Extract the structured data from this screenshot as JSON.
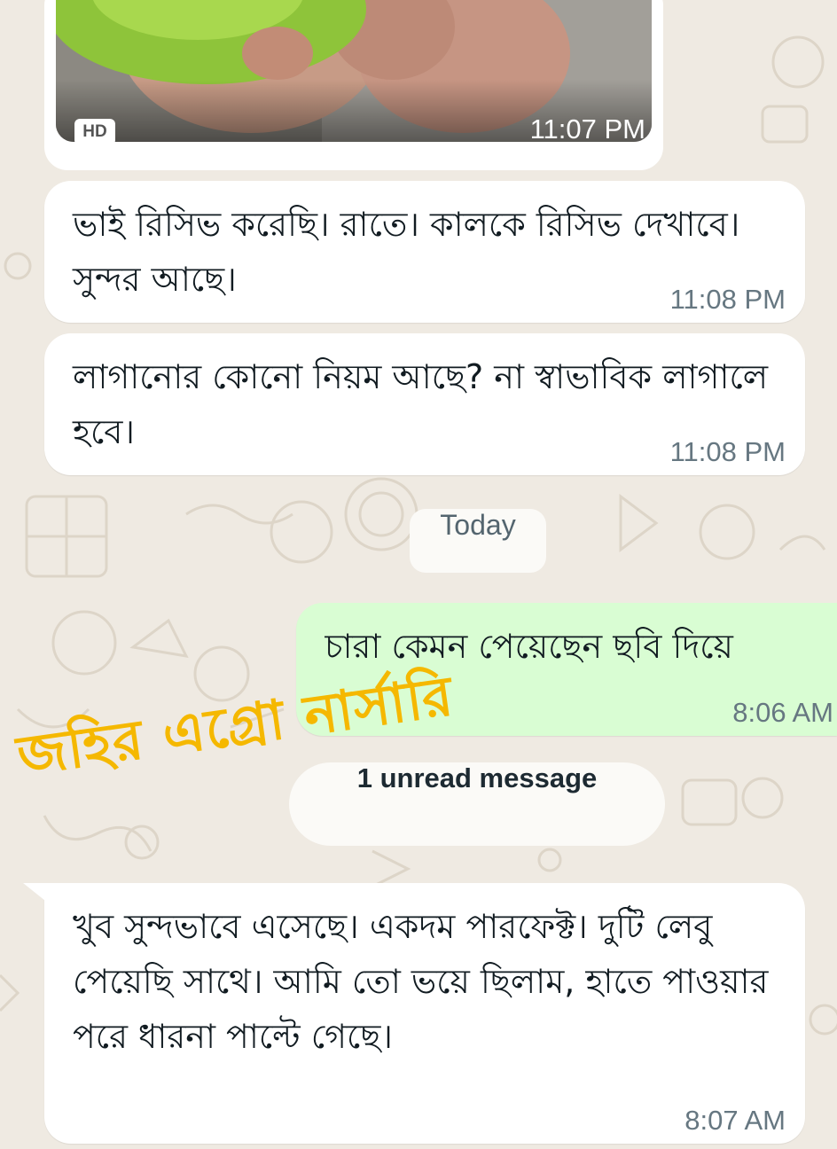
{
  "theme": {
    "background": "#efeae2",
    "incoming_bubble": "#ffffff",
    "outgoing_bubble": "#d9fdd3",
    "timestamp_color": "#667781",
    "watermark_color": "#f5b800"
  },
  "image_message": {
    "badge": "HD",
    "time": "11:07 PM"
  },
  "messages": [
    {
      "direction": "incoming",
      "text": "ভাই রিসিভ করেছি। রাতে। কালকে রিসিভ দেখাবে। সুন্দর আছে।",
      "time": "11:08 PM"
    },
    {
      "direction": "incoming",
      "text": "লাগানোর কোনো নিয়ম আছে? না স্বাভাবিক লাগালে হবে।",
      "time": "11:08 PM"
    },
    {
      "direction": "outgoing",
      "text": "চারা কেমন পেয়েছেন ছবি দিয়ে",
      "time": "8:06 AM"
    },
    {
      "direction": "incoming",
      "text": "খুব সুন্দভাবে এসেছে। একদম পারফেক্ট। দুটি লেবু পেয়েছি সাথে। আমি তো ভয়ে ছিলাম, হাতে পাওয়ার পরে ধারনা পাল্টে গেছে।",
      "time": "8:07 AM"
    }
  ],
  "date_separator": "Today",
  "unread_banner": "1 unread message",
  "watermark": "জহির এগ্রো নার্সারি"
}
